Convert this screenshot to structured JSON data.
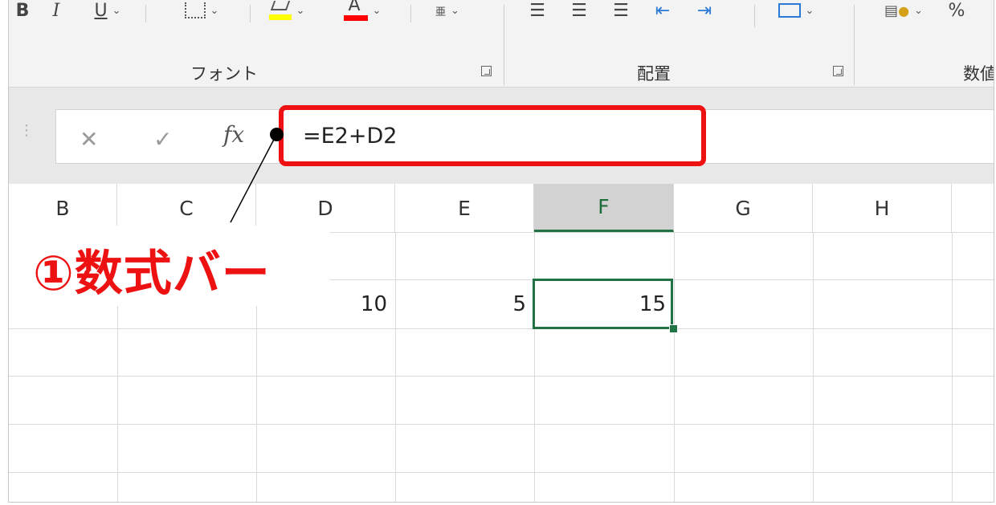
{
  "ribbon": {
    "font_group_label": "フォント",
    "align_group_label": "配置",
    "number_group_label": "数値",
    "glyphs": {
      "bold": "B",
      "italic": "I",
      "underline": "U",
      "phonetic": "亜",
      "percent": "%"
    },
    "highlight_color": "#ffff00",
    "font_color": "#ff0000"
  },
  "formula_bar": {
    "cancel_glyph": "✕",
    "enter_glyph": "✓",
    "fx_label": "fx",
    "formula": "=E2+D2"
  },
  "grid": {
    "columns": [
      "B",
      "C",
      "D",
      "E",
      "F",
      "G",
      "H"
    ],
    "active_column": "F",
    "row2": {
      "D": "10",
      "E": "5",
      "F": "15"
    }
  },
  "annotation": {
    "label": "①数式バー",
    "color": "#ee1111"
  }
}
